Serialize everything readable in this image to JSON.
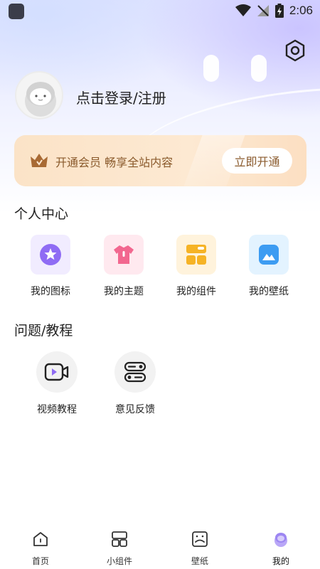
{
  "status_bar": {
    "time": "2:06",
    "icons": [
      "app-notification-icon",
      "wifi-icon",
      "signal-icon",
      "battery-icon"
    ]
  },
  "header": {
    "settings_icon": "gear-icon",
    "login_text": "点击登录/注册"
  },
  "vip_banner": {
    "icon": "crown-icon",
    "text": "开通会员 畅享全站内容",
    "button_label": "立即开通"
  },
  "personal_center": {
    "title": "个人中心",
    "items": [
      {
        "label": "我的图标",
        "icon": "star-icon",
        "bg": "#f1ecff",
        "color": "#8f6cf4"
      },
      {
        "label": "我的主题",
        "icon": "shirt-icon",
        "bg": "#ffe9ef",
        "color": "#f2678f"
      },
      {
        "label": "我的组件",
        "icon": "widgets-icon",
        "bg": "#fff3dc",
        "color": "#f6b325"
      },
      {
        "label": "我的壁纸",
        "icon": "image-icon",
        "bg": "#e3f3ff",
        "color": "#3d9cf2"
      }
    ]
  },
  "help": {
    "title": "问题/教程",
    "items": [
      {
        "label": "视频教程",
        "icon": "video-icon"
      },
      {
        "label": "意见反馈",
        "icon": "toggle-icon"
      }
    ]
  },
  "tab_bar": {
    "items": [
      {
        "label": "首页",
        "icon": "home-icon"
      },
      {
        "label": "小组件",
        "icon": "widget-icon"
      },
      {
        "label": "壁纸",
        "icon": "wallpaper-icon"
      },
      {
        "label": "我的",
        "icon": "profile-icon",
        "active": true
      }
    ]
  }
}
